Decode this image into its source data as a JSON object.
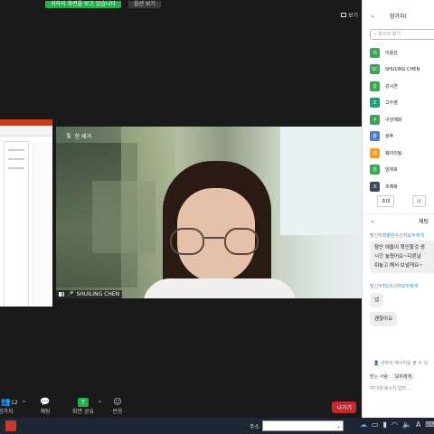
{
  "share_banner": {
    "message": "귀하의 화면을 보고 있습니다",
    "view_options": "옵션 보기"
  },
  "view_button": {
    "label": "보기",
    "icon": "grid-icon"
  },
  "video_tile": {
    "top_label": "한 제거",
    "name": "SHUILING CHEN"
  },
  "toolbar": {
    "participants_count": "12",
    "participants_label": "참가자",
    "chat_label": "채팅",
    "share_label": "화면 공유",
    "reactions_label": "반응",
    "leave_label": "나가기",
    "share_color": "#22b14c",
    "leave_color": "#c3272b"
  },
  "participants_panel": {
    "title": "참가자(",
    "search_placeholder": "참가자 찾기",
    "participants": [
      {
        "initial": "이",
        "name": "이용산",
        "color": "#3aa655"
      },
      {
        "initial": "SC",
        "name": "SHULING CHEN",
        "color": "#3aa655"
      },
      {
        "initial": "강",
        "name": "강시연",
        "color": "#3aa655"
      },
      {
        "initial": "고",
        "name": "고수영",
        "color": "#1f9e7a"
      },
      {
        "initial": "구",
        "name": "구강예화",
        "color": "#3aa655"
      },
      {
        "initial": "왕",
        "name": "왕후",
        "color": "#4a7fd6"
      },
      {
        "initial": "웨",
        "name": "웨이이팅",
        "color": "#f39c1f"
      },
      {
        "initial": "임",
        "name": "임재호",
        "color": "#3aa655"
      },
      {
        "initial": "조",
        "name": "조예화",
        "color": "#3b4a5e"
      }
    ],
    "invite_label": "초대",
    "more_label": "나"
  },
  "chat": {
    "title": "채팅",
    "messages": [
      {
        "from_prefix": "발신자",
        "sender": "최향란",
        "to_prefix": "수신자",
        "recipient": "모두에게",
        "lines": [
          "참안 애들이 확인할것 생",
          "시간 놓쳤어요~다른날",
          "줘놓고 해서 보낼게요~"
        ]
      },
      {
        "from_prefix": "발신자",
        "sender": "TQ",
        "to_prefix": "수신자",
        "recipient": "모두에게",
        "lines": [
          "넵",
          "괜찮아요"
        ]
      }
    ],
    "privacy_note": "귀하의 메시지를 볼 수 있",
    "to_label": "받는 사람:",
    "to_value": "모두에게",
    "input_placeholder": "여기에 메시지 입력..."
  },
  "taskbar": {
    "address_label": "주소",
    "tray_icons": [
      "cloud-icon",
      "monitor-icon",
      "battery-icon",
      "wifi-icon",
      "volume-icon",
      "ime-icon",
      "keyboard-icon"
    ]
  }
}
